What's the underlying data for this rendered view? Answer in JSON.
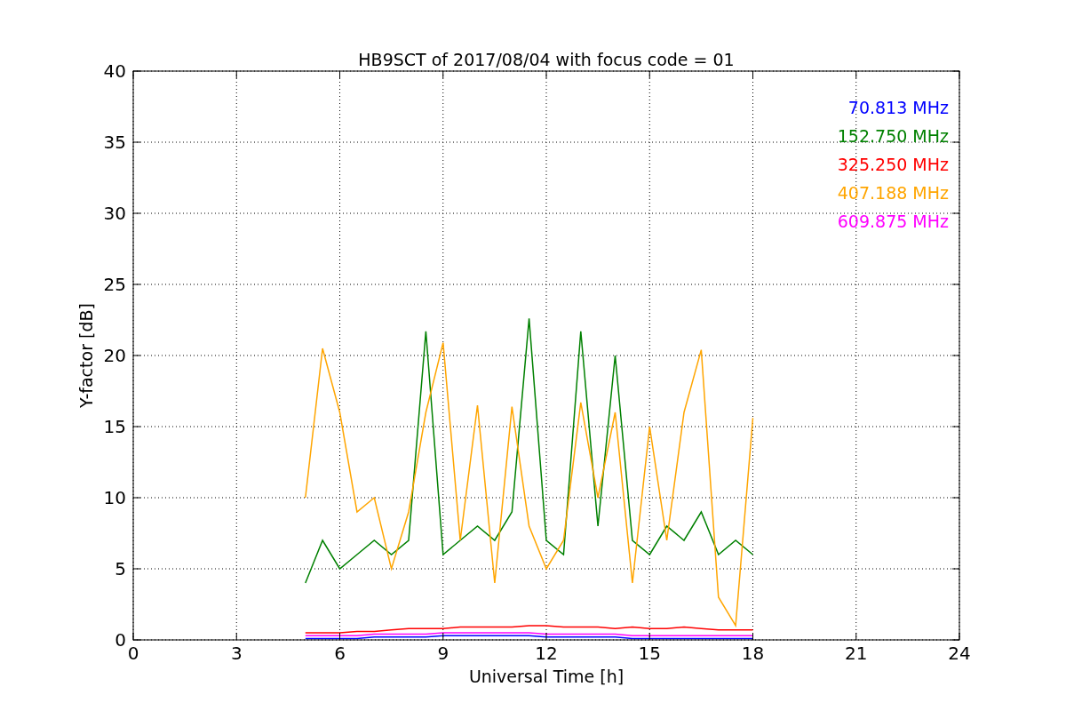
{
  "figure": {
    "chart_data": {
      "type": "line",
      "title": "HB9SCT of 2017/08/04 with focus code = 01",
      "xlabel": "Universal Time [h]",
      "ylabel": "Y-factor [dB]",
      "xlim": [
        0,
        24
      ],
      "ylim": [
        0,
        40
      ],
      "grid": true,
      "xticks": [
        0,
        3,
        6,
        9,
        12,
        15,
        18,
        21,
        24
      ],
      "yticks": [
        0,
        5,
        10,
        15,
        20,
        25,
        30,
        35,
        40
      ],
      "x": [
        5,
        5.5,
        6,
        6.5,
        7,
        7.5,
        8,
        8.5,
        9,
        9.5,
        10,
        10.5,
        11,
        11.5,
        12,
        12.5,
        13,
        13.5,
        14,
        14.5,
        15,
        15.5,
        16,
        16.5,
        17,
        17.5,
        18
      ],
      "series": [
        {
          "name": "70.813 MHz",
          "color": "#0000ff",
          "values": [
            0.1,
            0.1,
            0.1,
            0.1,
            0.2,
            0.2,
            0.2,
            0.2,
            0.3,
            0.3,
            0.3,
            0.3,
            0.3,
            0.3,
            0.2,
            0.2,
            0.2,
            0.2,
            0.2,
            0.1,
            0.1,
            0.1,
            0.1,
            0.1,
            0.1,
            0.1,
            0.1
          ]
        },
        {
          "name": "152.750 MHz",
          "color": "#008000",
          "values": [
            4,
            7,
            5,
            6,
            7,
            6,
            7,
            21.7,
            6,
            7,
            8,
            7,
            9,
            22.6,
            7,
            6,
            21.7,
            8,
            20,
            7,
            6,
            8,
            7,
            9,
            6,
            7,
            6
          ]
        },
        {
          "name": "325.250 MHz",
          "color": "#ff0000",
          "values": [
            0.5,
            0.5,
            0.5,
            0.6,
            0.6,
            0.7,
            0.8,
            0.8,
            0.8,
            0.9,
            0.9,
            0.9,
            0.9,
            1.0,
            1.0,
            0.9,
            0.9,
            0.9,
            0.8,
            0.9,
            0.8,
            0.8,
            0.9,
            0.8,
            0.7,
            0.7,
            0.7
          ]
        },
        {
          "name": "407.188 MHz",
          "color": "#ffa500",
          "values": [
            10,
            20.5,
            16,
            9,
            10,
            5,
            9,
            16,
            20.9,
            7,
            16.5,
            4,
            16.4,
            8,
            5,
            7,
            16.7,
            10,
            16,
            4,
            15,
            7,
            16,
            20.4,
            3,
            1,
            15.6
          ]
        },
        {
          "name": "609.875 MHz",
          "color": "#ff00ff",
          "values": [
            0.3,
            0.3,
            0.3,
            0.3,
            0.4,
            0.4,
            0.4,
            0.4,
            0.5,
            0.5,
            0.5,
            0.5,
            0.5,
            0.5,
            0.4,
            0.4,
            0.4,
            0.4,
            0.4,
            0.3,
            0.3,
            0.3,
            0.3,
            0.3,
            0.3,
            0.3,
            0.3
          ]
        }
      ]
    }
  }
}
